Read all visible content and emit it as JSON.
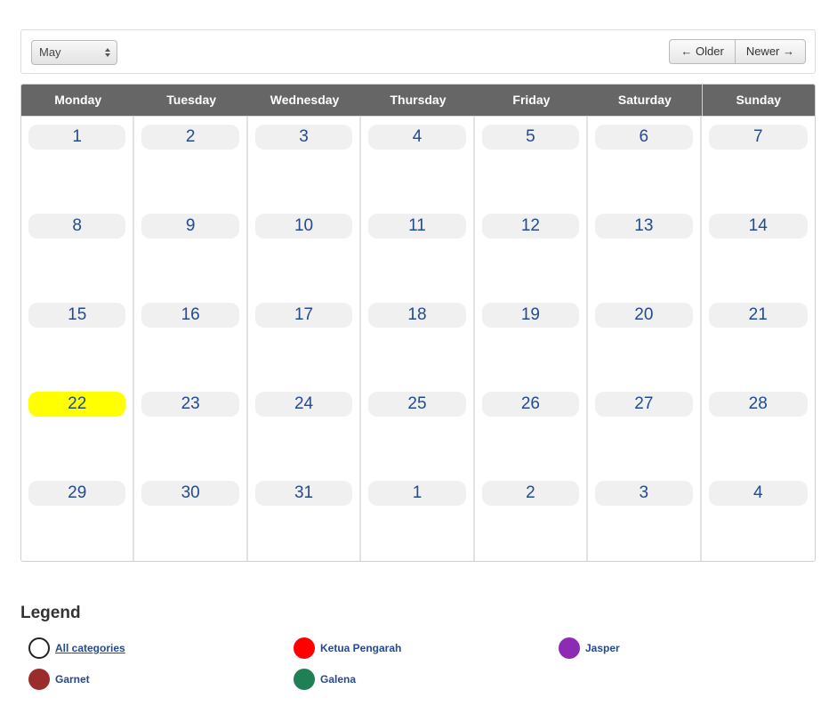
{
  "toolbar": {
    "month_value": "May",
    "older_label": "← Older",
    "newer_label": "Newer →"
  },
  "calendar": {
    "weekdays": [
      "Monday",
      "Tuesday",
      "Wednesday",
      "Thursday",
      "Friday",
      "Saturday",
      "Sunday"
    ],
    "weeks": [
      [
        "1",
        "2",
        "3",
        "4",
        "5",
        "6",
        "7"
      ],
      [
        "8",
        "9",
        "10",
        "11",
        "12",
        "13",
        "14"
      ],
      [
        "15",
        "16",
        "17",
        "18",
        "19",
        "20",
        "21"
      ],
      [
        "22",
        "23",
        "24",
        "25",
        "26",
        "27",
        "28"
      ],
      [
        "29",
        "30",
        "31",
        "1",
        "2",
        "3",
        "4"
      ]
    ],
    "today_color": "#ffff00"
  },
  "legend": {
    "title": "Legend",
    "items": [
      {
        "label": "All categories",
        "color": "#ffffff"
      },
      {
        "label": "Ketua Pengarah",
        "color": "#ff0000"
      },
      {
        "label": "Jasper",
        "color": "#8e2bb5"
      },
      {
        "label": "Garnet",
        "color": "#9b2c2c"
      },
      {
        "label": "Galena",
        "color": "#1f7f55"
      }
    ]
  }
}
